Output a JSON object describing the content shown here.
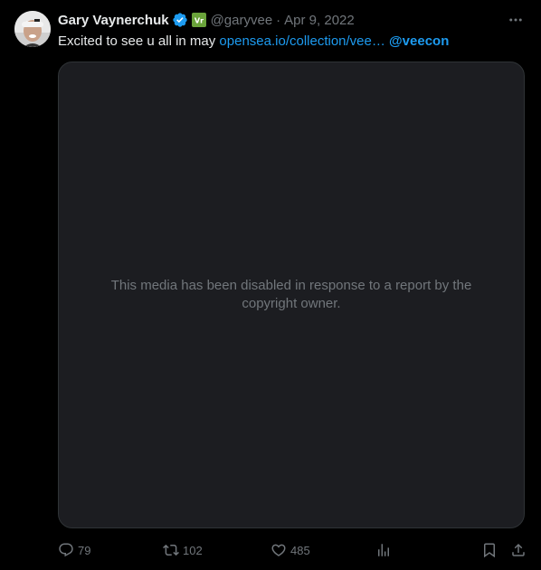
{
  "tweet": {
    "author_name": "Gary Vaynerchuk",
    "handle": "@garyvee",
    "separator": "·",
    "date": "Apr 9, 2022",
    "text_before": "Excited to see u all in may ",
    "link_text": "opensea.io/collection/vee…",
    "text_between": " ",
    "mention": "@veecon",
    "media_message": "This media has been disabled in response to a report by the copyright owner.",
    "more_icon": "more-horizontal-icon",
    "verified_icon": "verified-badge-icon",
    "affiliate_icon": "affiliate-badge-icon"
  },
  "actions": {
    "reply_count": "79",
    "retweet_count": "102",
    "like_count": "485",
    "reply_icon": "reply-icon",
    "retweet_icon": "retweet-icon",
    "like_icon": "heart-icon",
    "views_icon": "views-icon",
    "bookmark_icon": "bookmark-icon",
    "share_icon": "share-icon"
  },
  "colors": {
    "background": "#000000",
    "text": "#e7e9ea",
    "secondary": "#71767b",
    "accent": "#1d9bf0",
    "media_bg": "#1c1d21",
    "verified": "#1d9bf0",
    "affiliate": "#6aa33a"
  }
}
